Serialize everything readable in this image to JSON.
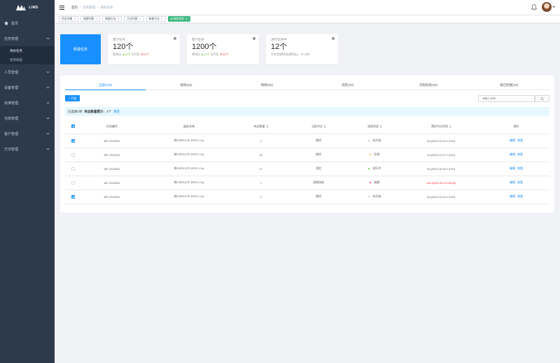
{
  "app": {
    "logo_text": "LIMS"
  },
  "sidebar": {
    "items": [
      {
        "label": "首页"
      },
      {
        "label": "任务管理"
      },
      {
        "label": "人员管理"
      },
      {
        "label": "设备管理"
      },
      {
        "label": "标准管理"
      },
      {
        "label": "仓库管理"
      },
      {
        "label": "客户管理"
      },
      {
        "label": "方法管理"
      }
    ],
    "submenu": [
      {
        "label": "待办任务"
      },
      {
        "label": "任务动态"
      }
    ]
  },
  "header": {
    "breadcrumb": [
      "首页",
      "任务管理",
      "待办任务"
    ]
  },
  "tags": [
    {
      "label": "任务详情"
    },
    {
      "label": "新建列表"
    },
    {
      "label": "新建方法"
    },
    {
      "label": "方法列表"
    },
    {
      "label": "新建方法"
    },
    {
      "label": "待办任务"
    }
  ],
  "stats": {
    "new_task_label": "新建任务",
    "cards": [
      {
        "label": "累计任务",
        "value": "120个",
        "foot_prefix": "周同比",
        "up_value": "▲12个",
        "mid_label": "日环比",
        "down_value": "▼12个"
      },
      {
        "label": "累计任务",
        "value": "1200个",
        "foot_prefix": "周同比",
        "up_value": "▲12个",
        "mid_label": "日环比",
        "down_value": "▼12个"
      },
      {
        "label": "进行任务中",
        "value": "12个",
        "foot_text": "平均完成时间(周同比)：47小时"
      }
    ]
  },
  "tabs": [
    {
      "label": "全部(120)"
    },
    {
      "label": "取样(20)"
    },
    {
      "label": "制样(30)"
    },
    {
      "label": "测定(20)"
    },
    {
      "label": "流程校核(30)"
    },
    {
      "label": "报告制版(20)"
    }
  ],
  "toolbar": {
    "add_label": "+ 开始",
    "search_placeholder": "请输入名称"
  },
  "selection": {
    "selected_text": "已选择2项",
    "total_label": "样品数量累计：",
    "total_value": "4个",
    "clear_label": "清空"
  },
  "table": {
    "columns": [
      "任务编号",
      "器具名称",
      "样品数量",
      "当前节点",
      "流程状态",
      "预估节点时间",
      "操作"
    ],
    "rows": [
      {
        "checked": true,
        "id": "WF-2310001",
        "name": "钢-SPEC(TP-SPEC-Cu)",
        "qty": "2",
        "node": "制样",
        "status": "未开始",
        "status_color": "#bfbfbf",
        "time": "3d (2023-10-24 12:00)",
        "overdue": false
      },
      {
        "checked": false,
        "id": "WF-2310001",
        "name": "钢-SPEC(TP-SPEC-Cu)",
        "qty": "16",
        "node": "取样",
        "status": "异常",
        "status_color": "#faad14",
        "time": "1d (2023-10-27 13:42)",
        "overdue": false
      },
      {
        "checked": false,
        "id": "WF-2310001",
        "name": "钢-SPEC(TP-SPEC-Cu)",
        "qty": "17",
        "node": "测定",
        "status": "进行中",
        "status_color": "#52c41a",
        "time": "3d (2023-10-24 12:00)",
        "overdue": false
      },
      {
        "checked": false,
        "id": "WF-2310001",
        "name": "钢-SPEC(TP-SPEC-Cu)",
        "qty": "2",
        "node": "流程校核",
        "status": "逾期",
        "status_color": "#f5222d",
        "time": "14d (2023-10-13 09:00)",
        "overdue": true
      },
      {
        "checked": true,
        "id": "WF-2310001",
        "name": "钢-SPEC(TP-SPEC-Cu)",
        "qty": "2",
        "node": "制样",
        "status": "未开始",
        "status_color": "#bfbfbf",
        "time": "3d (2023-10-24 12:00)",
        "overdue": false
      }
    ],
    "op_labels": [
      "编辑",
      "查看"
    ]
  }
}
